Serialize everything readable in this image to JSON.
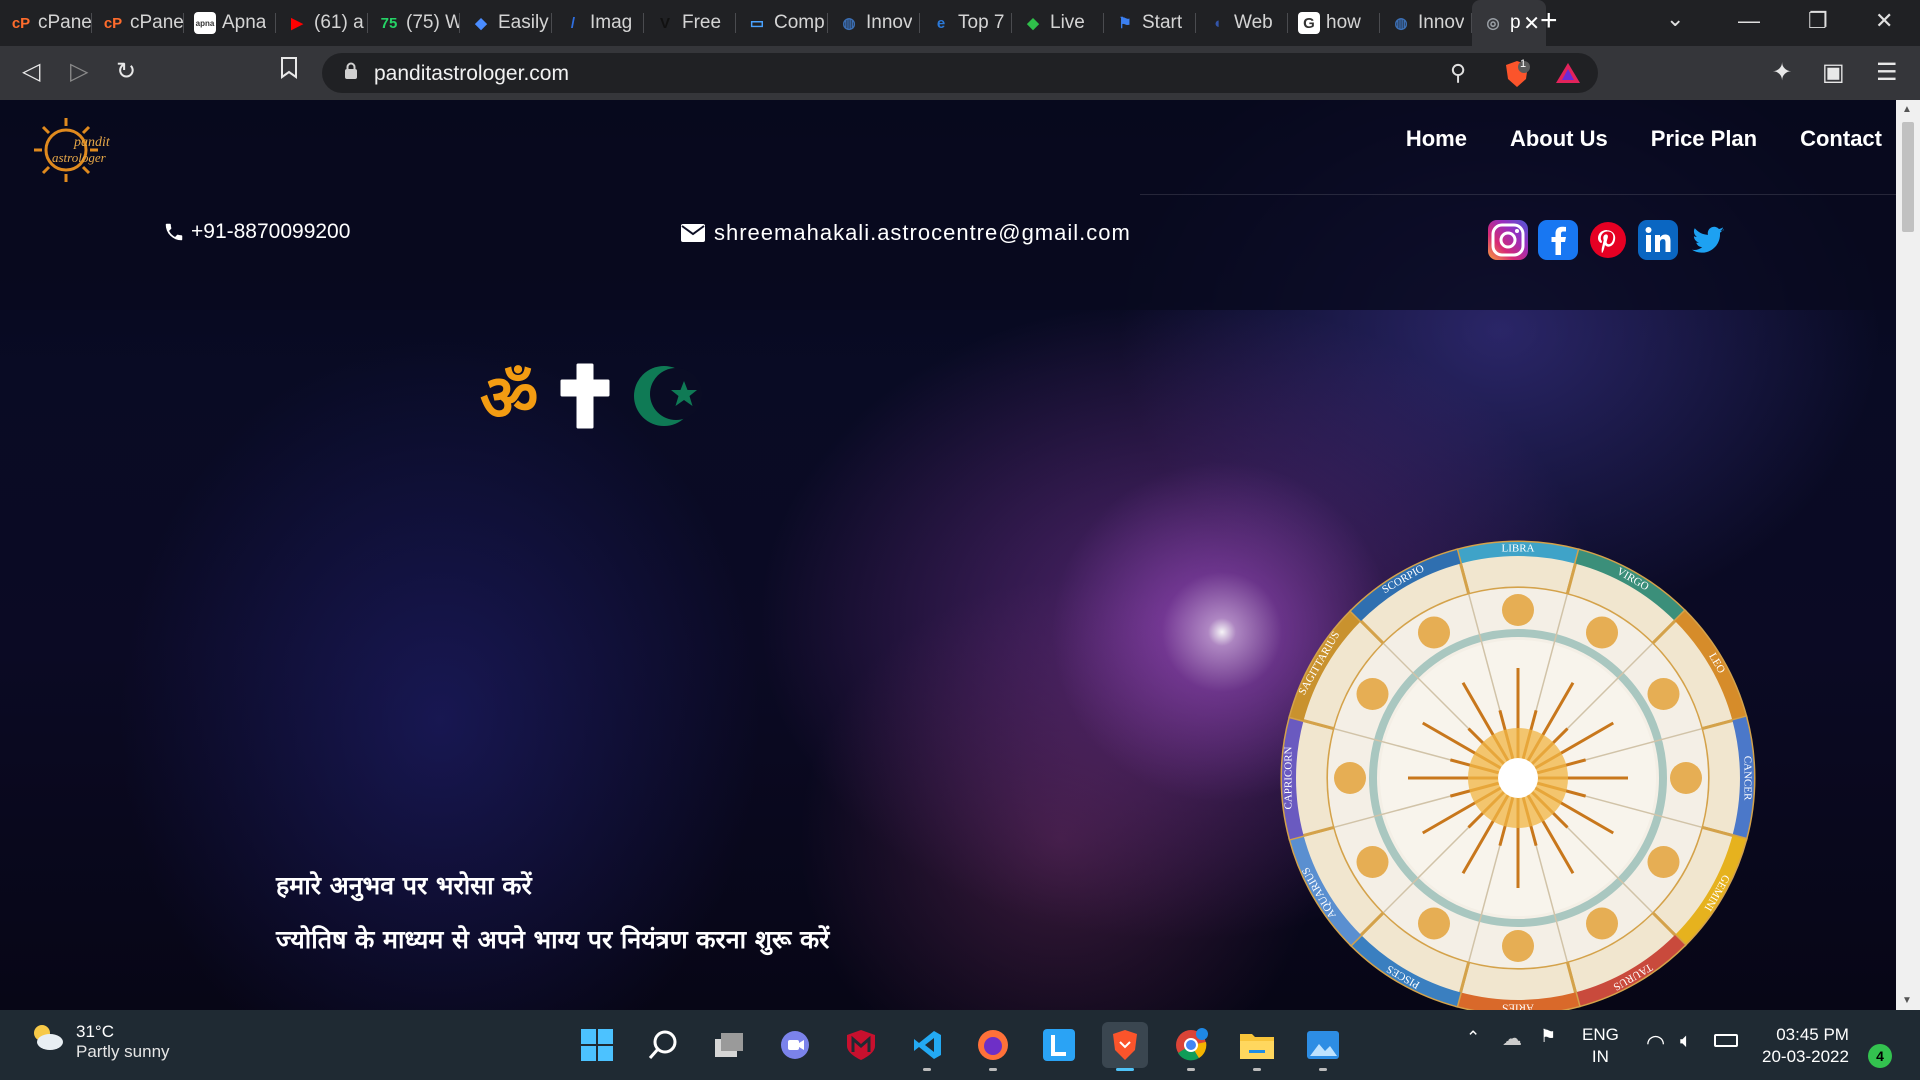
{
  "browser": {
    "tabs": [
      {
        "label": "cPane",
        "icon": "cpanel-icon",
        "color": "#ff6c2c",
        "glyph": "cP"
      },
      {
        "label": "cPane",
        "icon": "cpanel-icon",
        "color": "#ff6c2c",
        "glyph": "cP"
      },
      {
        "label": "Apna",
        "icon": "apna-icon",
        "color": "#ffffff",
        "glyph": "apna"
      },
      {
        "label": "(61) a",
        "icon": "youtube-icon",
        "color": "#ff0000",
        "glyph": "▶"
      },
      {
        "label": "(75) W",
        "icon": "whatsapp-icon",
        "color": "#25d366",
        "glyph": "75"
      },
      {
        "label": "Easily",
        "icon": "gem-icon",
        "color": "#4a8cff",
        "glyph": "◆"
      },
      {
        "label": "Imag",
        "icon": "image-tool-icon",
        "color": "#2f6fe0",
        "glyph": "/"
      },
      {
        "label": "Free",
        "icon": "v-icon",
        "color": "#111111",
        "glyph": "V"
      },
      {
        "label": "Comp",
        "icon": "window-icon",
        "color": "#4aa3ff",
        "glyph": "▭"
      },
      {
        "label": "Innov",
        "icon": "globe-icon",
        "color": "#3b6fb5",
        "glyph": "◍"
      },
      {
        "label": "Top 7",
        "icon": "e-icon",
        "color": "#2b79d8",
        "glyph": "e"
      },
      {
        "label": "Live",
        "icon": "diamond-icon",
        "color": "#2fbf4a",
        "glyph": "◆"
      },
      {
        "label": "Start",
        "icon": "flag-icon",
        "color": "#3b7ff0",
        "glyph": "⚑"
      },
      {
        "label": "Web",
        "icon": "web-icon",
        "color": "#3355aa",
        "glyph": "◖"
      },
      {
        "label": "how",
        "icon": "google-icon",
        "color": "#ffffff",
        "glyph": "G"
      },
      {
        "label": "Innov",
        "icon": "globe-icon",
        "color": "#3b6fb5",
        "glyph": "◍"
      },
      {
        "label": "p",
        "icon": "site-icon",
        "color": "#9aa0a6",
        "glyph": "◎",
        "active": true
      }
    ],
    "url": "panditastrologer.com",
    "shield_count": "1"
  },
  "site": {
    "logo_text_1": "pandit",
    "logo_text_2": "astrologer",
    "nav": [
      "Home",
      "About Us",
      "Price Plan",
      "Contact"
    ],
    "phone": "+91-8870099200",
    "email": "shreemahakali.astrocentre@gmail.com",
    "socials": [
      {
        "name": "instagram-icon",
        "color": "#c13584"
      },
      {
        "name": "facebook-icon",
        "color": "#1877f2"
      },
      {
        "name": "pinterest-icon",
        "color": "#e60023"
      },
      {
        "name": "linkedin-icon",
        "color": "#0a66c2"
      },
      {
        "name": "twitter-icon",
        "color": "#1da1f2"
      }
    ],
    "om_symbol": "ॐ",
    "tagline_1": "हमारे अनुभव पर भरोसा करें",
    "tagline_2": "ज्योतिष के माध्यम से अपने भाग्य पर नियंत्रण करना शुरू करें",
    "zodiac_labels": [
      "LIBRA",
      "VIRGO",
      "LEO",
      "CANCER",
      "GEMINI",
      "TAURUS",
      "ARIES",
      "PISCES",
      "AQUARIUS",
      "CAPRICORN",
      "SAGITTARIUS",
      "SCORPIO"
    ]
  },
  "taskbar": {
    "temperature": "31°C",
    "weather": "Partly sunny",
    "language_1": "ENG",
    "language_2": "IN",
    "time": "03:45 PM",
    "date": "20-03-2022",
    "notifications": "4"
  }
}
